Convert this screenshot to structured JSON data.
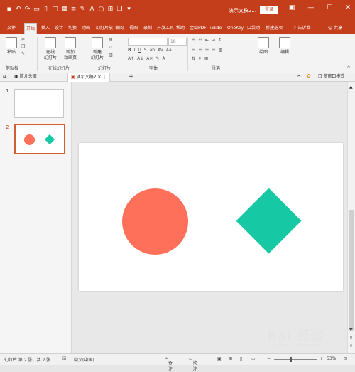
{
  "titlebar": {
    "doc_title": "演示文稿2...",
    "login": "登录",
    "bg_color": "#c43e1c"
  },
  "tabs": [
    {
      "label": "文件",
      "active": false
    },
    {
      "label": "开始",
      "active": true
    },
    {
      "label": "插入",
      "active": false
    },
    {
      "label": "设计",
      "active": false
    },
    {
      "label": "切换",
      "active": false
    },
    {
      "label": "动画",
      "active": false
    },
    {
      "label": "幻灯片放",
      "active": false
    },
    {
      "label": "审阅",
      "active": false
    },
    {
      "label": "视图",
      "active": false
    },
    {
      "label": "录制",
      "active": false
    },
    {
      "label": "开发工具",
      "active": false
    },
    {
      "label": "帮助",
      "active": false
    },
    {
      "label": "金山PDF",
      "active": false
    },
    {
      "label": "iSlide",
      "active": false
    },
    {
      "label": "OneKey",
      "active": false
    },
    {
      "label": "口袋动",
      "active": false
    },
    {
      "label": "新建选项",
      "active": false
    }
  ],
  "tell_me": "告诉我",
  "share": "共享",
  "ribbon": {
    "paste": "粘贴",
    "clipboard_group": "剪贴板",
    "online_slides_1": "在线",
    "online_slides_2": "幻灯片",
    "new_anim_1": "新加",
    "new_anim_2": "动画页",
    "online_group": "在线幻灯片",
    "new_slide_1": "新建",
    "new_slide_2": "幻灯片",
    "slides_group": "幻灯片",
    "font_size": "18",
    "font_group": "字体",
    "para_group": "段落",
    "draw": "绘图",
    "edit": "编辑"
  },
  "doc_tabs": {
    "tab1": "简介头图",
    "tab2": "演示文稿2",
    "add": "+",
    "multiwindow": "多窗口模式"
  },
  "thumbnails": [
    {
      "num": "1"
    },
    {
      "num": "2"
    }
  ],
  "shapes": {
    "circle_color": "#ff705a",
    "diamond_color": "#16c8a4"
  },
  "status": {
    "slide_info": "幻灯片 第 2 张，共 2 张",
    "language": "中文(中国)",
    "notes": "备注",
    "comments": "批注",
    "zoom": "53%"
  },
  "watermark": {
    "main": "Bai 经验",
    "sub": "jingyan.baidu.com"
  }
}
